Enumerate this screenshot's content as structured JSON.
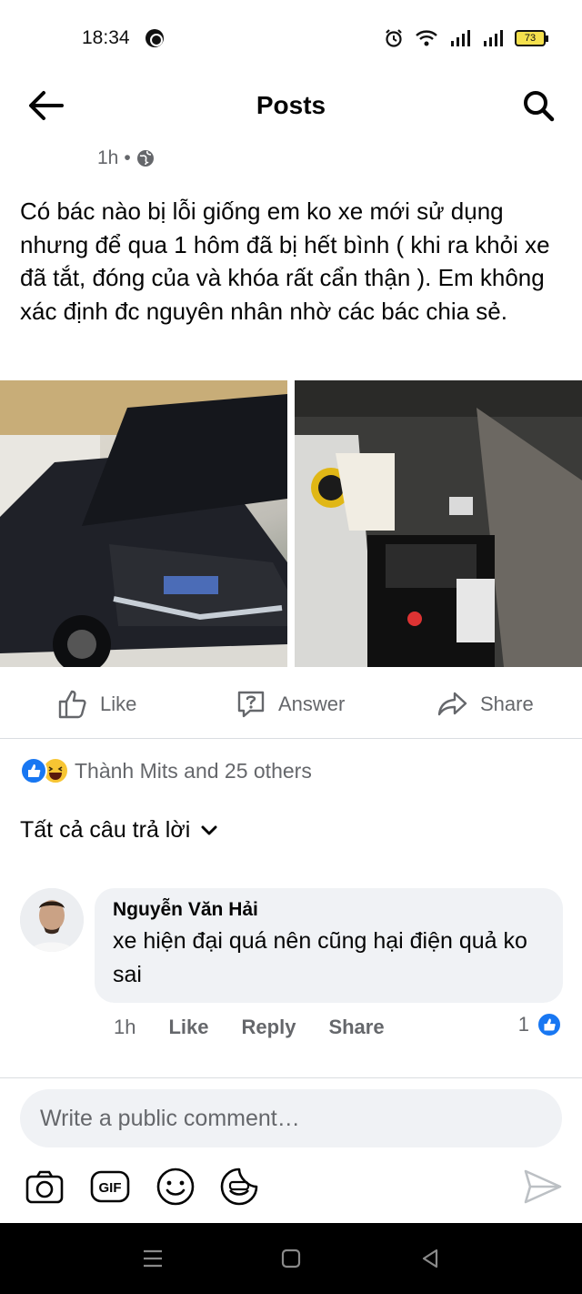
{
  "status": {
    "time": "18:34",
    "battery": "73"
  },
  "nav": {
    "title": "Posts",
    "back_icon": "arrow-left-icon",
    "search_icon": "search-icon"
  },
  "post": {
    "age": "1h",
    "audience_icon": "globe-icon",
    "text": "Có bác nào bị lỗi giống em ko xe mới sử dụng nhưng để qua 1 hôm đã bị hết bình ( khi ra khỏi xe đã tắt, đóng của và khóa rất cẩn thận ). Em không xác định đc nguyên nhân nhờ các bác chia sẻ."
  },
  "actions": {
    "like": "Like",
    "answer": "Answer",
    "share": "Share"
  },
  "reactions": {
    "summary": "Thành Mits and 25 others",
    "icons": [
      "like-icon",
      "haha-icon"
    ]
  },
  "filter": {
    "label": "Tất cả câu trả lời"
  },
  "comment": {
    "author": "Nguyễn Văn Hải",
    "text": "xe hiện đại quá nên cũng hại điện quả ko sai",
    "time": "1h",
    "like": "Like",
    "reply": "Reply",
    "share": "Share",
    "reaction_count": "1"
  },
  "composer": {
    "placeholder": "Write a public comment…"
  },
  "colors": {
    "accent": "#1877f2",
    "secondary_text": "#65676b",
    "bubble": "#f0f2f5"
  }
}
